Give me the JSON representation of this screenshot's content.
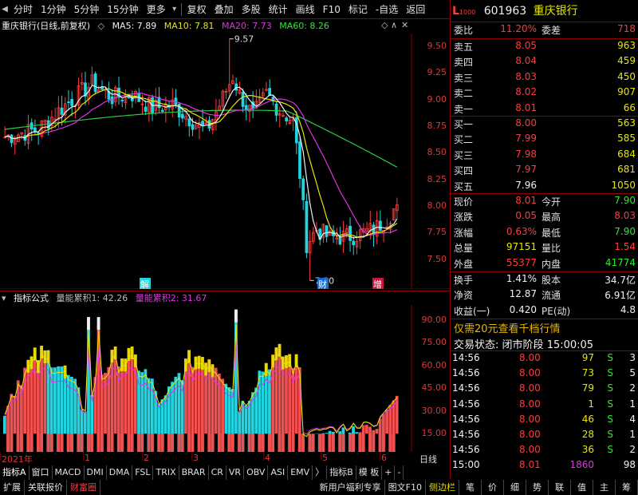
{
  "toolbar": {
    "left": [
      "分时",
      "1分钟",
      "5分钟",
      "15分钟",
      "更多"
    ],
    "right": [
      "复权",
      "叠加",
      "多股",
      "统计",
      "画线",
      "F10",
      "标记",
      "-自选",
      "返回"
    ]
  },
  "main_legend": {
    "title": "重庆银行(日线,前复权)",
    "ma5": "MA5: 7.89",
    "ma10": "MA10: 7.81",
    "ma20": "MA20: 7.73",
    "ma60": "MA60: 8.26",
    "high_label": "9.57",
    "low_label": "7.30",
    "event_labels": [
      "解",
      "财",
      "增"
    ]
  },
  "sub_legend": {
    "title": "指标公式",
    "line1": "量能累积1: 42.26",
    "line2": "量能累积2: 31.67"
  },
  "y_ticks_main": [
    "9.50",
    "9.25",
    "9.00",
    "8.75",
    "8.50",
    "8.25",
    "8.00",
    "7.75",
    "7.50"
  ],
  "y_ticks_sub": [
    "90.00",
    "75.00",
    "60.00",
    "45.00",
    "30.00",
    "15.00"
  ],
  "x_axis": {
    "labels": [
      "2021年",
      "1",
      "2",
      "3",
      "4",
      "5",
      "6"
    ],
    "period": "日线"
  },
  "tabs_row1": [
    "指标A",
    "窗口",
    "MACD",
    "DMI",
    "DMA",
    "FSL",
    "TRIX",
    "BRAR",
    "CR",
    "VR",
    "OBV",
    "ASI",
    "EMV",
    "〉",
    "指标B",
    "模 板",
    "+",
    "-"
  ],
  "tabs_row2_left": [
    "扩展",
    "关联报价",
    "财富圈"
  ],
  "tabs_row2_mid": [
    "新用户福利专享",
    "图文F10",
    "侧边栏"
  ],
  "tabs_row2_right": [
    "笔",
    "价",
    "细",
    "势",
    "联",
    "值",
    "主",
    "筹"
  ],
  "stock": {
    "code": "601963",
    "name": "重庆银行",
    "l2": "L",
    "l2_sub": "1000"
  },
  "order_ratio": {
    "label1": "委比",
    "value1": "11.20%",
    "label2": "委差",
    "value2": "718"
  },
  "asks": [
    {
      "label": "卖五",
      "price": "8.05",
      "vol": "963"
    },
    {
      "label": "卖四",
      "price": "8.04",
      "vol": "459"
    },
    {
      "label": "卖三",
      "price": "8.03",
      "vol": "450"
    },
    {
      "label": "卖二",
      "price": "8.02",
      "vol": "907"
    },
    {
      "label": "卖一",
      "price": "8.01",
      "vol": "66"
    }
  ],
  "bids": [
    {
      "label": "买一",
      "price": "8.00",
      "vol": "563"
    },
    {
      "label": "买二",
      "price": "7.99",
      "vol": "585"
    },
    {
      "label": "买三",
      "price": "7.98",
      "vol": "684"
    },
    {
      "label": "买四",
      "price": "7.97",
      "vol": "681"
    },
    {
      "label": "买五",
      "price": "7.96",
      "vol": "1050"
    }
  ],
  "quote": [
    {
      "l1": "现价",
      "v1": "8.01",
      "l2": "今开",
      "v2": "7.90"
    },
    {
      "l1": "涨跌",
      "v1": "0.05",
      "l2": "最高",
      "v2": "8.03"
    },
    {
      "l1": "涨幅",
      "v1": "0.63%",
      "l2": "最低",
      "v2": "7.90"
    },
    {
      "l1": "总量",
      "v1": "97151",
      "l2": "量比",
      "v2": "1.54"
    },
    {
      "l1": "外盘",
      "v1": "55377",
      "l2": "内盘",
      "v2": "41774"
    }
  ],
  "stats": [
    {
      "l1": "换手",
      "v1": "1.41%",
      "l2": "股本",
      "v2": "34.7亿"
    },
    {
      "l1": "净资",
      "v1": "12.87",
      "l2": "流通",
      "v2": "6.91亿"
    },
    {
      "l1": "收益(一)",
      "v1": "0.420",
      "l2": "PE(动)",
      "v2": "4.8"
    }
  ],
  "promo": "仅需20元查看千档行情",
  "status": {
    "label": "交易状态:",
    "value": "闭市阶段",
    "time": "15:00:05"
  },
  "trades": [
    {
      "time": "14:56",
      "price": "8.00",
      "vol": "97",
      "side": "S",
      "n": "3"
    },
    {
      "time": "14:56",
      "price": "8.00",
      "vol": "73",
      "side": "S",
      "n": "5"
    },
    {
      "time": "14:56",
      "price": "8.00",
      "vol": "79",
      "side": "S",
      "n": "2"
    },
    {
      "time": "14:56",
      "price": "8.00",
      "vol": "1",
      "side": "S",
      "n": "1"
    },
    {
      "time": "14:56",
      "price": "8.00",
      "vol": "46",
      "side": "S",
      "n": "4"
    },
    {
      "time": "14:56",
      "price": "8.00",
      "vol": "28",
      "side": "S",
      "n": "1"
    },
    {
      "time": "14:56",
      "price": "8.00",
      "vol": "36",
      "side": "S",
      "n": "2"
    },
    {
      "time": "15:00",
      "price": "8.01",
      "vol": "1860",
      "side": "",
      "n": "98"
    }
  ],
  "colors": {
    "up": "#ff3b3b",
    "down": "#2ee82e",
    "bar_up": "#f05050",
    "bar_down": "#22d4e0",
    "ma5": "#f0f0f0",
    "ma10": "#e6e600",
    "ma20": "#e033e0",
    "ma60": "#2ecc40",
    "grid": "#8b0000"
  }
}
